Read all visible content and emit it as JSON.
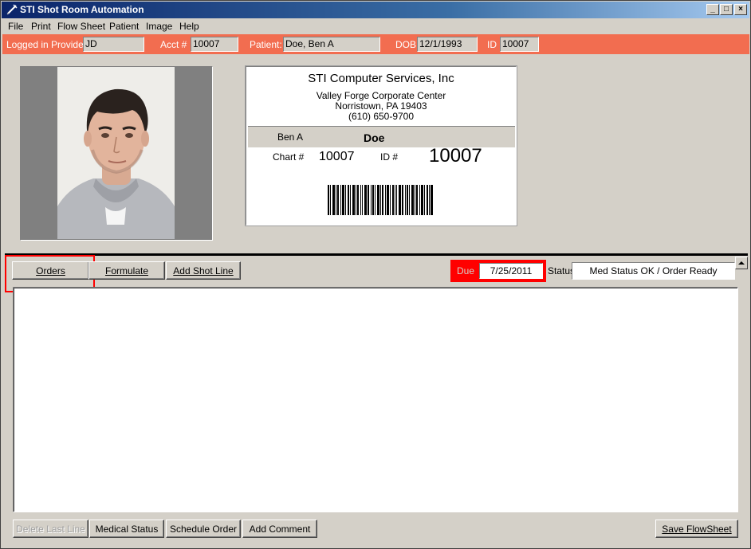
{
  "window": {
    "title": "STI Shot Room Automation",
    "controls": {
      "minimize": "_",
      "maximize": "□",
      "close": "×"
    }
  },
  "menu": [
    "File",
    "Print",
    "Flow Sheet",
    "Patient",
    "Image",
    "Help"
  ],
  "info_bar": {
    "provider_label": "Logged in Provider:",
    "provider_value": "JD",
    "acct_label": "Acct #",
    "acct_value": "10007",
    "patient_label": "Patient:",
    "patient_value": "Doe, Ben A",
    "dob_label": "DOB",
    "dob_value": "12/1/1993",
    "id_label": "ID",
    "id_value": "10007"
  },
  "card": {
    "company": "STI Computer Services, Inc",
    "address1": "Valley Forge Corporate Center",
    "address2": "Norristown, PA 19403",
    "phone": "(610) 650-9700",
    "first_name": "Ben A",
    "last_name": "Doe",
    "chart_label": "Chart #",
    "chart_value": "10007",
    "id_label": "ID #",
    "id_value": "10007"
  },
  "toolbar": {
    "orders": "Orders",
    "formulate": "Formulate",
    "add_shot_line": "Add Shot Line"
  },
  "due": {
    "label": "Due",
    "value": "7/25/2011"
  },
  "status": {
    "label": "Status",
    "value": "Med Status OK / Order Ready"
  },
  "bottom_buttons": {
    "delete_last_line": "Delete Last Line",
    "medical_status": "Medical Status",
    "schedule_order": "Schedule Order",
    "add_comment": "Add Comment",
    "save_flowsheet": "Save FlowSheet"
  },
  "colors": {
    "info_bar": "#f26d50",
    "highlight": "#ff0000",
    "title_gradient_start": "#0a246a",
    "window_bg": "#d4d0c8"
  },
  "icons": {
    "app": "syringe-icon",
    "scroll_up": "up-arrow-icon"
  }
}
